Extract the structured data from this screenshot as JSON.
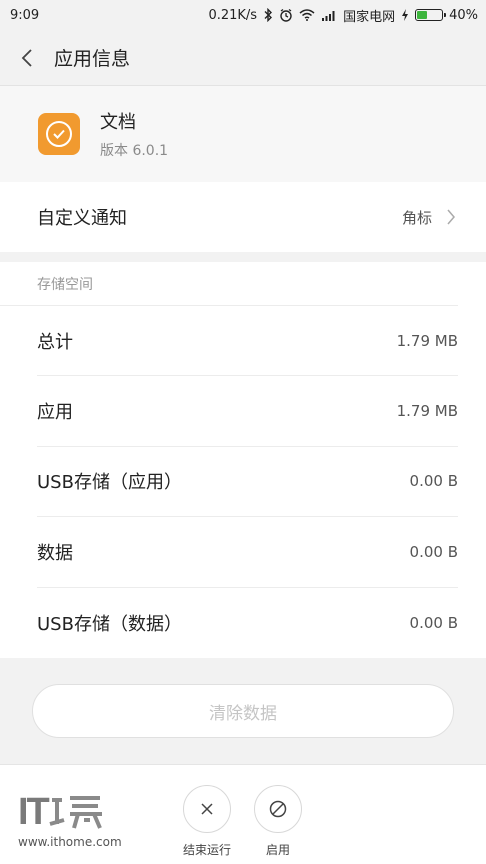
{
  "status_bar": {
    "time": "9:09",
    "speed": "0.21K/s",
    "carrier": "国家电网",
    "battery": "40%",
    "battery_level": 0.4,
    "icons": [
      "bluetooth-icon",
      "alarm-icon",
      "wifi-icon",
      "signal-icon",
      "charging-icon",
      "battery-icon"
    ]
  },
  "header": {
    "title": "应用信息"
  },
  "app": {
    "name": "文档",
    "version": "版本 6.0.1",
    "icon_color": "#f19a2f"
  },
  "notification": {
    "label": "自定义通知",
    "value": "角标"
  },
  "storage": {
    "section_label": "存储空间",
    "rows": [
      {
        "label": "总计",
        "value": "1.79 MB"
      },
      {
        "label": "应用",
        "value": "1.79 MB"
      },
      {
        "label": "USB存储（应用）",
        "value": "0.00 B"
      },
      {
        "label": "数据",
        "value": "0.00 B"
      },
      {
        "label": "USB存储（数据）",
        "value": "0.00 B"
      }
    ]
  },
  "clear_button": {
    "label": "清除数据"
  },
  "bottom_actions": {
    "stop_label": "结束运行",
    "enable_label": "启用"
  },
  "watermark": {
    "logo_text": "IT",
    "logo_glyph": "之家",
    "url": "www.ithome.com"
  }
}
